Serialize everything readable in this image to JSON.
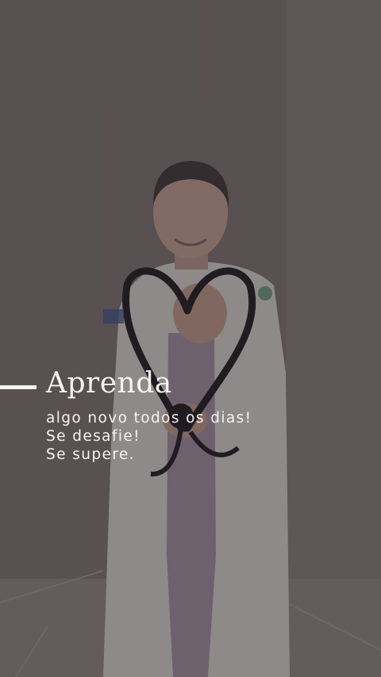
{
  "story": {
    "headline": "Aprenda",
    "lines": [
      "algo novo todos os dias!",
      "Se desafie!",
      "Se supere."
    ]
  },
  "colors": {
    "text": "#f6f3f2",
    "accent_line": "#f4f1f0",
    "background": "#6f6666"
  }
}
